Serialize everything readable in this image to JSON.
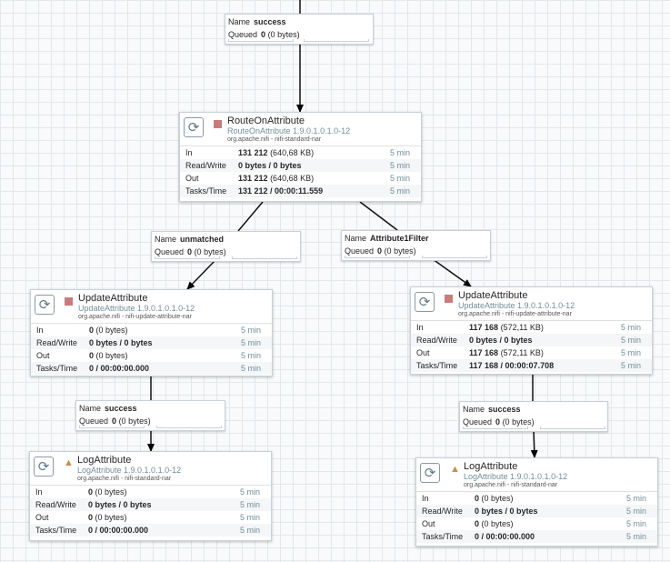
{
  "processors": {
    "route": {
      "name": "RouteOnAttribute",
      "type": "RouteOnAttribute 1.9.0.1.0.1.0-12",
      "bundle": "org.apache.nifi - nifi-standard-nar",
      "state": "stopped",
      "stats": {
        "in_label": "In",
        "in_value": "131 212",
        "in_sub": "(640,68 KB)",
        "in_time": "5 min",
        "rw_label": "Read/Write",
        "rw_value": "0 bytes / 0 bytes",
        "rw_time": "5 min",
        "out_label": "Out",
        "out_value": "131 212",
        "out_sub": "(640,68 KB)",
        "out_time": "5 min",
        "tasks_label": "Tasks/Time",
        "tasks_value": "131 212 / 00:00:11.559",
        "tasks_time": "5 min"
      }
    },
    "update_left": {
      "name": "UpdateAttribute",
      "type": "UpdateAttribute 1.9.0.1.0.1.0-12",
      "bundle": "org.apache.nifi - nifi-update-attribute-nar",
      "state": "stopped",
      "stats": {
        "in_label": "In",
        "in_value": "0",
        "in_sub": "(0 bytes)",
        "in_time": "5 min",
        "rw_label": "Read/Write",
        "rw_value": "0 bytes / 0 bytes",
        "rw_time": "5 min",
        "out_label": "Out",
        "out_value": "0",
        "out_sub": "(0 bytes)",
        "out_time": "5 min",
        "tasks_label": "Tasks/Time",
        "tasks_value": "0 / 00:00:00.000",
        "tasks_time": "5 min"
      }
    },
    "update_right": {
      "name": "UpdateAttribute",
      "type": "UpdateAttribute 1.9.0.1.0.1.0-12",
      "bundle": "org.apache.nifi - nifi-update-attribute-nar",
      "state": "stopped",
      "stats": {
        "in_label": "In",
        "in_value": "117 168",
        "in_sub": "(572,11 KB)",
        "in_time": "5 min",
        "rw_label": "Read/Write",
        "rw_value": "0 bytes / 0 bytes",
        "rw_time": "5 min",
        "out_label": "Out",
        "out_value": "117 168",
        "out_sub": "(572,11 KB)",
        "out_time": "5 min",
        "tasks_label": "Tasks/Time",
        "tasks_value": "117 168 / 00:00:07.708",
        "tasks_time": "5 min"
      }
    },
    "log_left": {
      "name": "LogAttribute",
      "type": "LogAttribute 1.9.0.1.0.1.0-12",
      "bundle": "org.apache.nifi - nifi-standard-nar",
      "state": "invalid",
      "stats": {
        "in_label": "In",
        "in_value": "0",
        "in_sub": "(0 bytes)",
        "in_time": "5 min",
        "rw_label": "Read/Write",
        "rw_value": "0 bytes / 0 bytes",
        "rw_time": "5 min",
        "out_label": "Out",
        "out_value": "0",
        "out_sub": "(0 bytes)",
        "out_time": "5 min",
        "tasks_label": "Tasks/Time",
        "tasks_value": "0 / 00:00:00.000",
        "tasks_time": "5 min"
      }
    },
    "log_right": {
      "name": "LogAttribute",
      "type": "LogAttribute 1.9.0.1.0.1.0-12",
      "bundle": "org.apache.nifi - nifi-standard-nar",
      "state": "invalid",
      "stats": {
        "in_label": "In",
        "in_value": "0",
        "in_sub": "(0 bytes)",
        "in_time": "5 min",
        "rw_label": "Read/Write",
        "rw_value": "0 bytes / 0 bytes",
        "rw_time": "5 min",
        "out_label": "Out",
        "out_value": "0",
        "out_sub": "(0 bytes)",
        "out_time": "5 min",
        "tasks_label": "Tasks/Time",
        "tasks_value": "0 / 00:00:00.000",
        "tasks_time": "5 min"
      }
    }
  },
  "connections": {
    "top": {
      "name_label": "Name",
      "name": "success",
      "queued_label": "Queued",
      "queued_count": "0",
      "queued_size": "(0 bytes)"
    },
    "unmatched": {
      "name_label": "Name",
      "name": "unmatched",
      "queued_label": "Queued",
      "queued_count": "0",
      "queued_size": "(0 bytes)"
    },
    "attr_filter": {
      "name_label": "Name",
      "name": "Attribute1Filter",
      "queued_label": "Queued",
      "queued_count": "0",
      "queued_size": "(0 bytes)"
    },
    "success_left": {
      "name_label": "Name",
      "name": "success",
      "queued_label": "Queued",
      "queued_count": "0",
      "queued_size": "(0 bytes)"
    },
    "success_right": {
      "name_label": "Name",
      "name": "success",
      "queued_label": "Queued",
      "queued_count": "0",
      "queued_size": "(0 bytes)"
    }
  },
  "icons": {
    "processor_type": "processor-icon",
    "stopped": "stopped-state-icon",
    "invalid": "warning-icon"
  },
  "colors": {
    "stopped": "#c97b7b",
    "invalid": "#c0914e",
    "type_text": "#728e9b",
    "canvas_grid": "#e3e8eb"
  }
}
